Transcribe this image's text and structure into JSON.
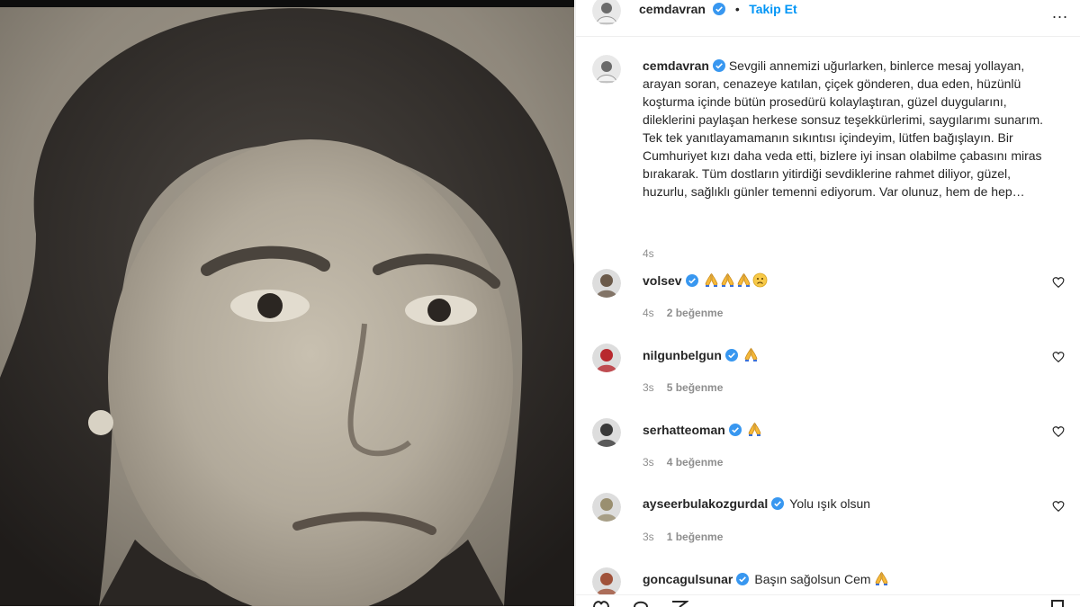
{
  "header": {
    "username": "cemdavran",
    "follow_label": "Takip Et",
    "separator": "•",
    "more_label": "..."
  },
  "caption": {
    "username": "cemdavran",
    "text": "Sevgili annemizi uğurlarken, binlerce mesaj yollayan, arayan soran, cenazeye katılan, çiçek gönderen, dua eden, hüzünlü koşturma içinde bütün prosedürü kolaylaştıran, güzel duygularını, dileklerini paylaşan herkese sonsuz teşekkürlerimi, saygılarımı sunarım. Tek tek yanıtlayamamanın sıkıntısı içindeyim, lütfen bağışlayın. Bir Cumhuriyet kızı daha veda etti, bizlere iyi insan olabilme çabasını miras bırakarak. Tüm dostların yitirdiği sevdiklerine rahmet diliyor, güzel, huzurlu, sağlıklı günler temenni ediyorum. Var olunuz, hem de hep…",
    "time": "4s"
  },
  "comments": [
    {
      "username": "volsev",
      "text": "",
      "emojis": [
        "pray",
        "pray",
        "pray",
        "sad"
      ],
      "time": "4s",
      "likes": "2 beğenme",
      "avatar_color": "#6b5a4a"
    },
    {
      "username": "nilgunbelgun",
      "text": "",
      "emojis": [
        "pray"
      ],
      "time": "3s",
      "likes": "5 beğenme",
      "avatar_color": "#b8282e"
    },
    {
      "username": "serhatteoman",
      "text": "",
      "emojis": [
        "pray"
      ],
      "time": "3s",
      "likes": "4 beğenme",
      "avatar_color": "#3a3a3a"
    },
    {
      "username": "ayseerbulakozgurdal",
      "text": "Yolu ışık olsun",
      "emojis": [],
      "time": "3s",
      "likes": "1 beğenme",
      "avatar_color": "#9a8f70"
    },
    {
      "username": "goncagulsunar",
      "text": "Başın sağolsun Cem",
      "emojis": [
        "pray"
      ],
      "time": "",
      "likes": "",
      "avatar_color": "#a0523a"
    }
  ],
  "colors": {
    "accent": "#0095f6",
    "verified": "#3897f0",
    "muted": "#8e8e8e",
    "text": "#262626"
  }
}
